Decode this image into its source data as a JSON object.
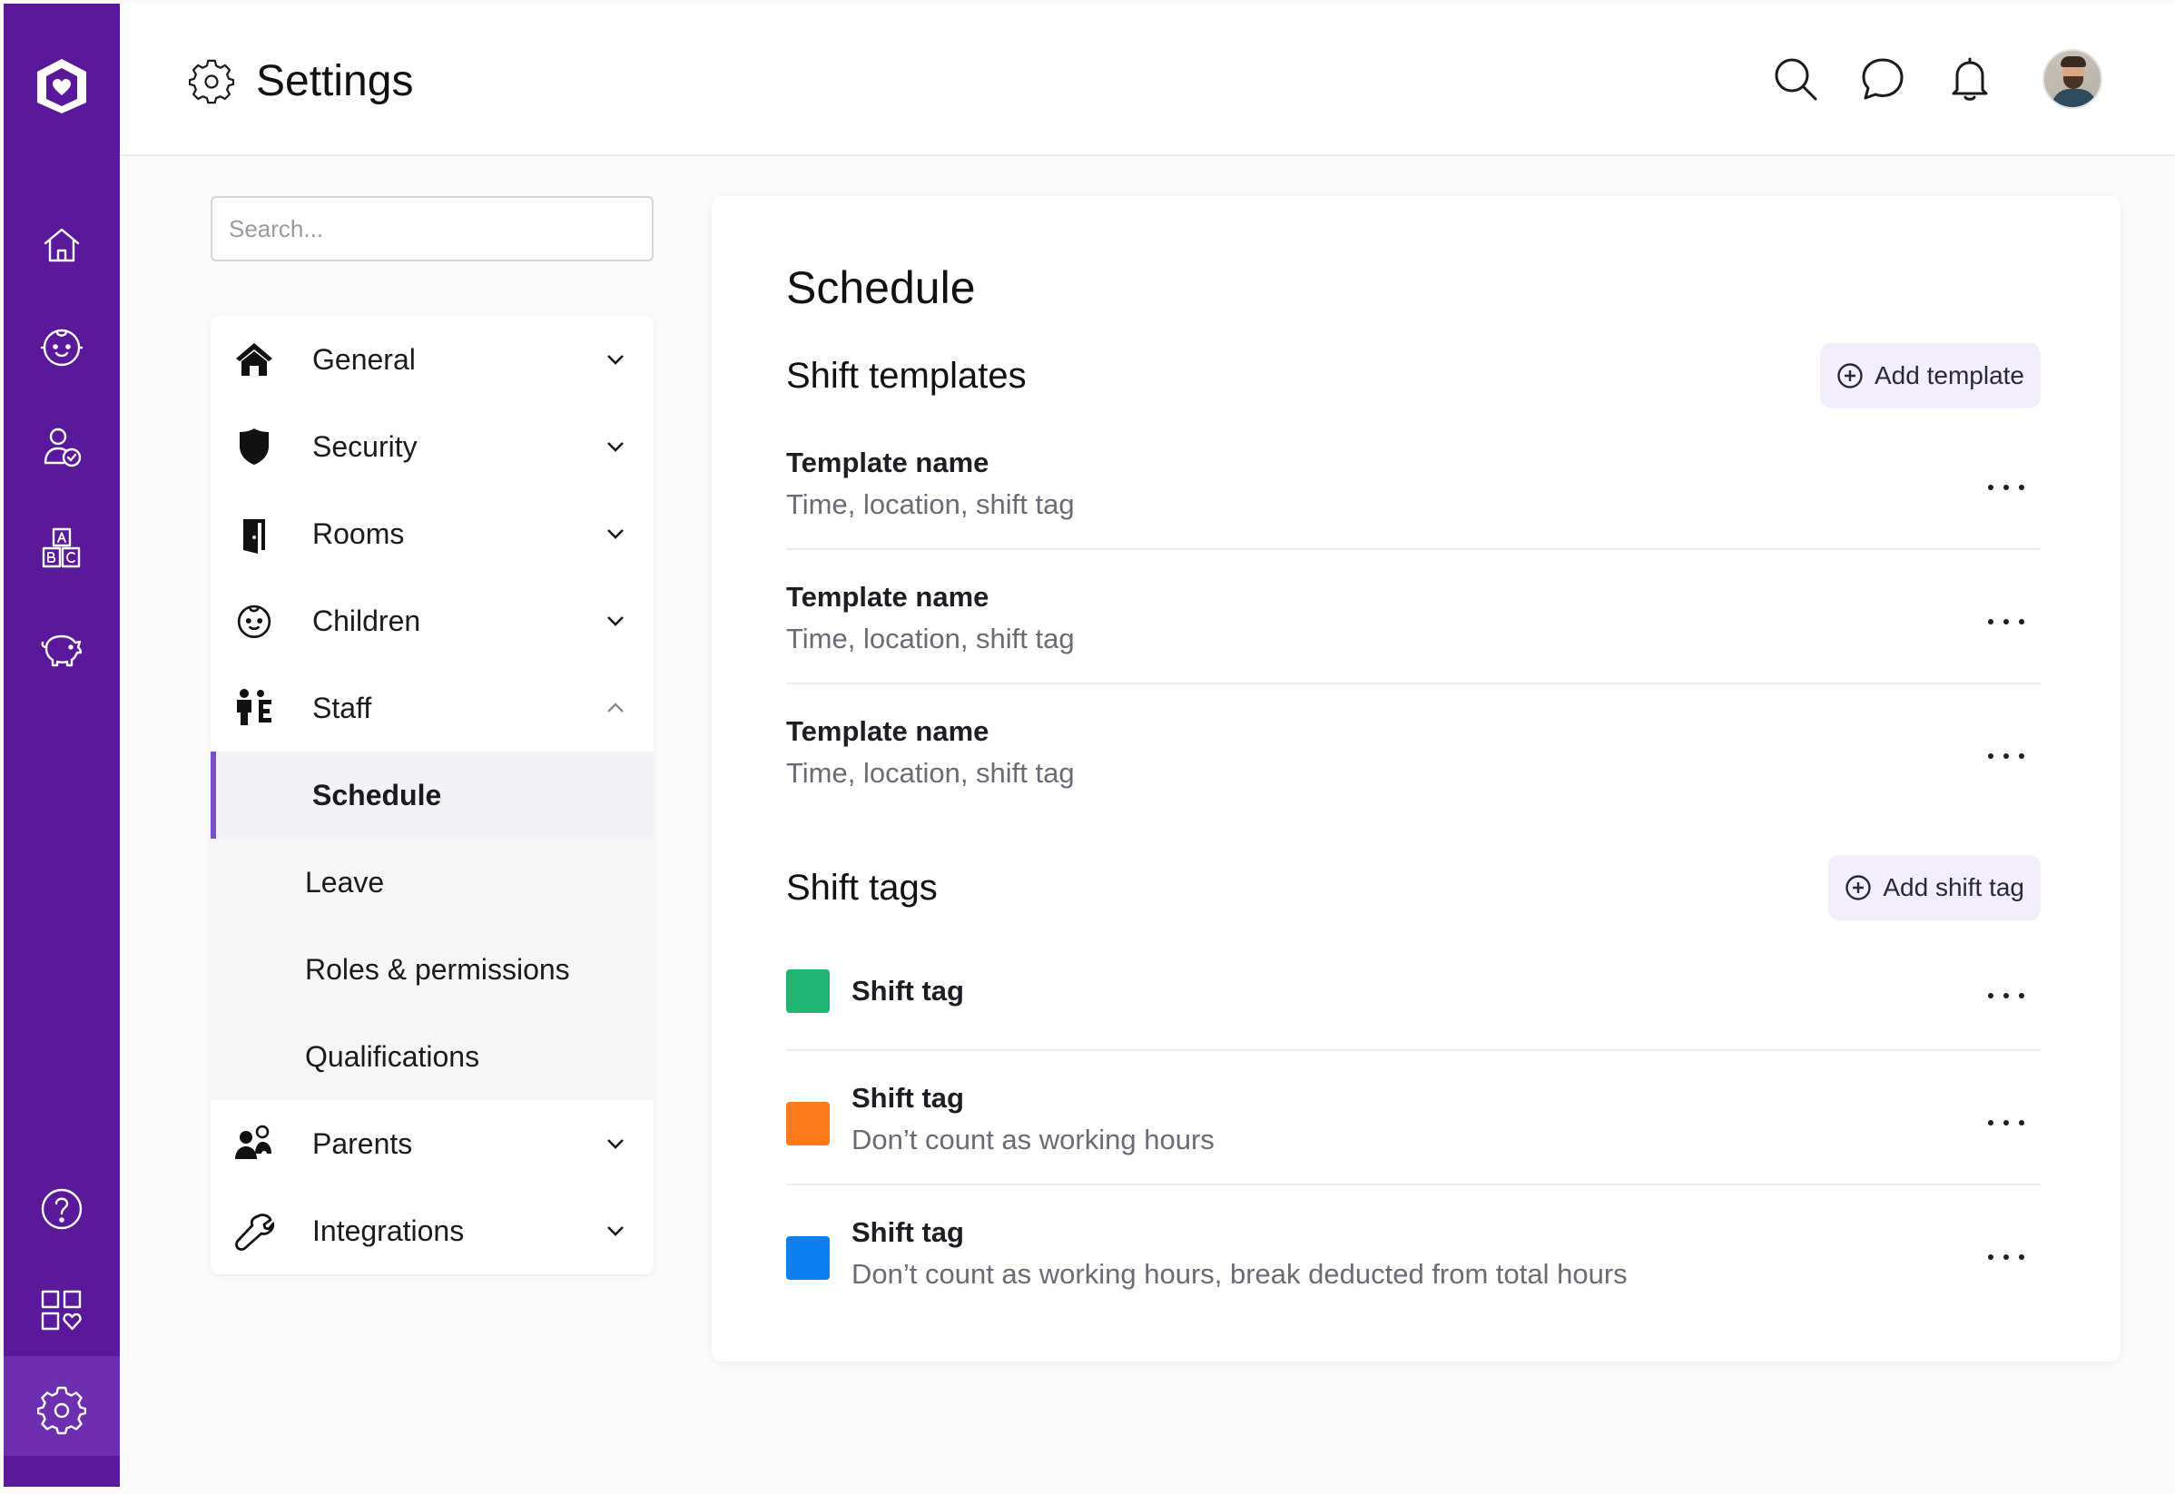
{
  "header": {
    "title": "Settings",
    "icons": [
      "search-icon",
      "chat-icon",
      "bell-icon",
      "avatar"
    ]
  },
  "rail": {
    "icons": [
      "home-icon",
      "child-face-icon",
      "staff-check-icon",
      "abc-blocks-icon",
      "piggy-bank-icon",
      "help-icon",
      "apps-icon",
      "settings-icon"
    ],
    "accent": "#5a189a"
  },
  "search": {
    "placeholder": "Search..."
  },
  "nav": {
    "items": [
      {
        "label": "General",
        "icon": "house-icon"
      },
      {
        "label": "Security",
        "icon": "shield-icon"
      },
      {
        "label": "Rooms",
        "icon": "door-icon"
      },
      {
        "label": "Children",
        "icon": "child-face-icon"
      },
      {
        "label": "Staff",
        "icon": "staff-icon"
      },
      {
        "label": "Parents",
        "icon": "parents-icon"
      },
      {
        "label": "Integrations",
        "icon": "wrench-icon"
      }
    ],
    "staff_sub": [
      {
        "label": "Schedule",
        "active": true
      },
      {
        "label": "Leave"
      },
      {
        "label": "Roles & permissions"
      },
      {
        "label": "Qualifications"
      }
    ]
  },
  "content": {
    "title": "Schedule",
    "templates": {
      "title": "Shift templates",
      "add_label": "Add template",
      "rows": [
        {
          "name": "Template name",
          "desc": "Time, location, shift tag"
        },
        {
          "name": "Template name",
          "desc": "Time, location, shift tag"
        },
        {
          "name": "Template name",
          "desc": "Time, location, shift tag"
        }
      ]
    },
    "tags": {
      "title": "Shift tags",
      "add_label": "Add shift tag",
      "rows": [
        {
          "name": "Shift tag",
          "desc": "",
          "color": "#21b573"
        },
        {
          "name": "Shift tag",
          "desc": "Don’t count as working hours",
          "color": "#ff7a1a"
        },
        {
          "name": "Shift tag",
          "desc": "Don’t count as working hours, break deducted from total hours",
          "color": "#0a7ff0"
        }
      ]
    }
  }
}
